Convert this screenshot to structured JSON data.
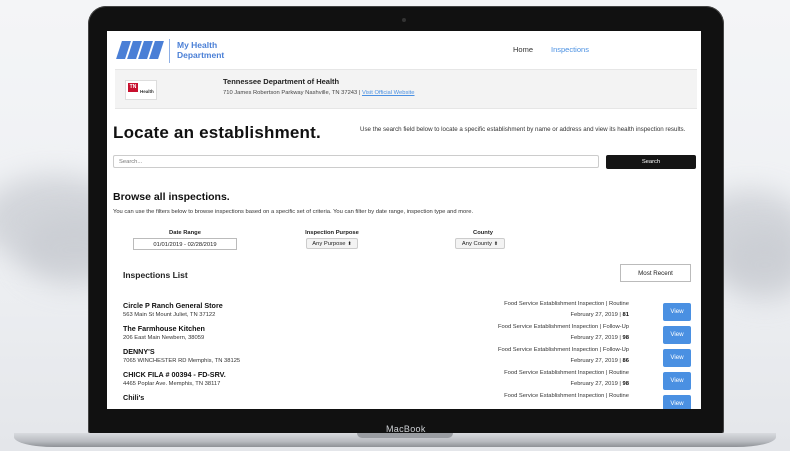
{
  "site": {
    "logo_line1": "My Health",
    "logo_line2": "Department",
    "nav": {
      "home": "Home",
      "inspections": "Inspections"
    }
  },
  "department": {
    "logo_abbr": "TN",
    "logo_text": "Health",
    "name": "Tennessee Department of Health",
    "address": "710 James Robertson Parkway Nashville, TN 37243 | ",
    "website_link": "Visit Official Website"
  },
  "locate": {
    "title": "Locate an establishment.",
    "description": "Use the search field below to locate a specific establishment by name or address and view its health inspection results.",
    "search_placeholder": "Search...",
    "search_button": "Search"
  },
  "browse": {
    "title": "Browse all inspections.",
    "description": "You can use the filters below to browse inspections based on a specific set of criteria. You can filter by date range, inspection type and more.",
    "filters": {
      "date_label": "Date Range",
      "date_value": "01/01/2019 - 02/28/2019",
      "purpose_label": "Inspection Purpose",
      "purpose_value": "Any Purpose",
      "county_label": "County",
      "county_value": "Any County"
    }
  },
  "list": {
    "title": "Inspections List",
    "sort_button": "Most Recent",
    "view_label": "View",
    "rows": [
      {
        "name": "Circle P Ranch General Store",
        "address": "563 Main St Mount Juliet, TN 37122",
        "type": "Food Service Establishment Inspection | Routine",
        "date": "February 27, 2019 | ",
        "score": "81"
      },
      {
        "name": "The Farmhouse Kitchen",
        "address": "206 East Main Newbern, 38059",
        "type": "Food Service Establishment Inspection | Follow-Up",
        "date": "February 27, 2019 | ",
        "score": "98"
      },
      {
        "name": "DENNY'S",
        "address": "7065 WINCHESTER RD Memphis, TN 38125",
        "type": "Food Service Establishment Inspection | Follow-Up",
        "date": "February 27, 2019 | ",
        "score": "86"
      },
      {
        "name": "CHICK FILA # 00394 - FD-SRV.",
        "address": "4465 Poplar Ave. Memphis, TN 38117",
        "type": "Food Service Establishment Inspection | Routine",
        "date": "February 27, 2019 | ",
        "score": "98"
      },
      {
        "name": "Chili's",
        "address": "",
        "type": "Food Service Establishment Inspection | Routine",
        "date": "",
        "score": ""
      }
    ]
  },
  "device": {
    "brand": "MacBook"
  },
  "colors": {
    "accent": "#4a90e2",
    "logo_blue": "#4a7fd6",
    "dark_button": "#151515"
  }
}
